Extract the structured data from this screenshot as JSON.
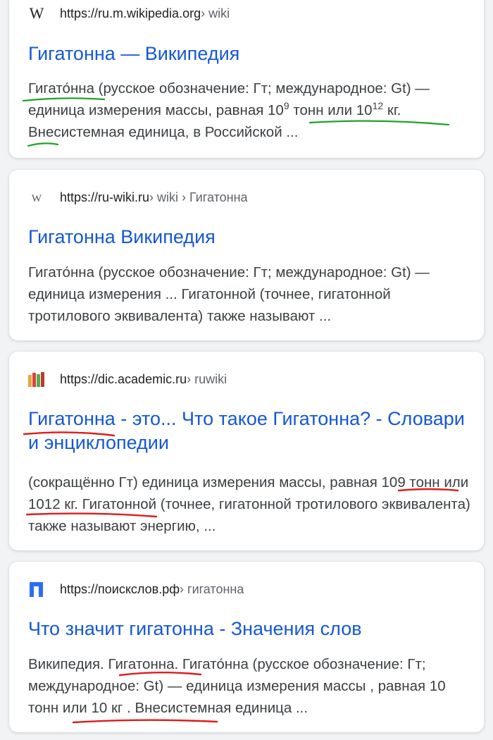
{
  "results": [
    {
      "url_host": "https://ru.m.wikipedia.org",
      "url_path": " › wiki",
      "favicon": "wikipedia-w-icon",
      "title": "Гигатонна — Википедия",
      "snippet_1": "Гигато́нна (русское обозначение: Гт; международное: Gt) — единица измерения массы, равная 10",
      "snippet_sup1": "9",
      "snippet_2": " тонн или 10",
      "snippet_sup2": "12",
      "snippet_3": " кг. Внесистемная единица, в Российской ..."
    },
    {
      "url_host": "https://ru-wiki.ru",
      "url_path": " › wiki › Гигатонна",
      "favicon": "wiki-w-small-icon",
      "title": "Гигатонна Википедия",
      "snippet": "Гигато́нна (русское обозначение: Гт; международное: Gt) — единица измерения ... Гигатонной (точнее, гигатонной тротилового эквивалента) также называют ..."
    },
    {
      "url_host": "https://dic.academic.ru",
      "url_path": " › ruwiki",
      "favicon": "books-icon",
      "title": "Гигатонна - это... Что такое Гигатонна? - Словари и энциклопедии",
      "snippet": "(сокращённо Гт) единица измерения массы, равная 109 тонн или 1012 кг. Гигатонной (точнее, гигатонной тротилового эквивалента) также называют энергию, ..."
    },
    {
      "url_host": "https://поискслов.рф",
      "url_path": " › гигатонна",
      "favicon": "p-letter-icon",
      "title": "Что значит гигатонна - Значения слов",
      "snippet": "Википедия. Гигатонна. Гигато́нна (русское обозначение: Гт; международное: Gt) — единица измерения массы , равная 10 тонн или 10 кг . Внесистемная единица ..."
    }
  ],
  "colors": {
    "title_link": "#1558d6",
    "annotation_green": "#1fa32a",
    "annotation_red": "#e01b1b",
    "background": "#f1f3f4"
  }
}
